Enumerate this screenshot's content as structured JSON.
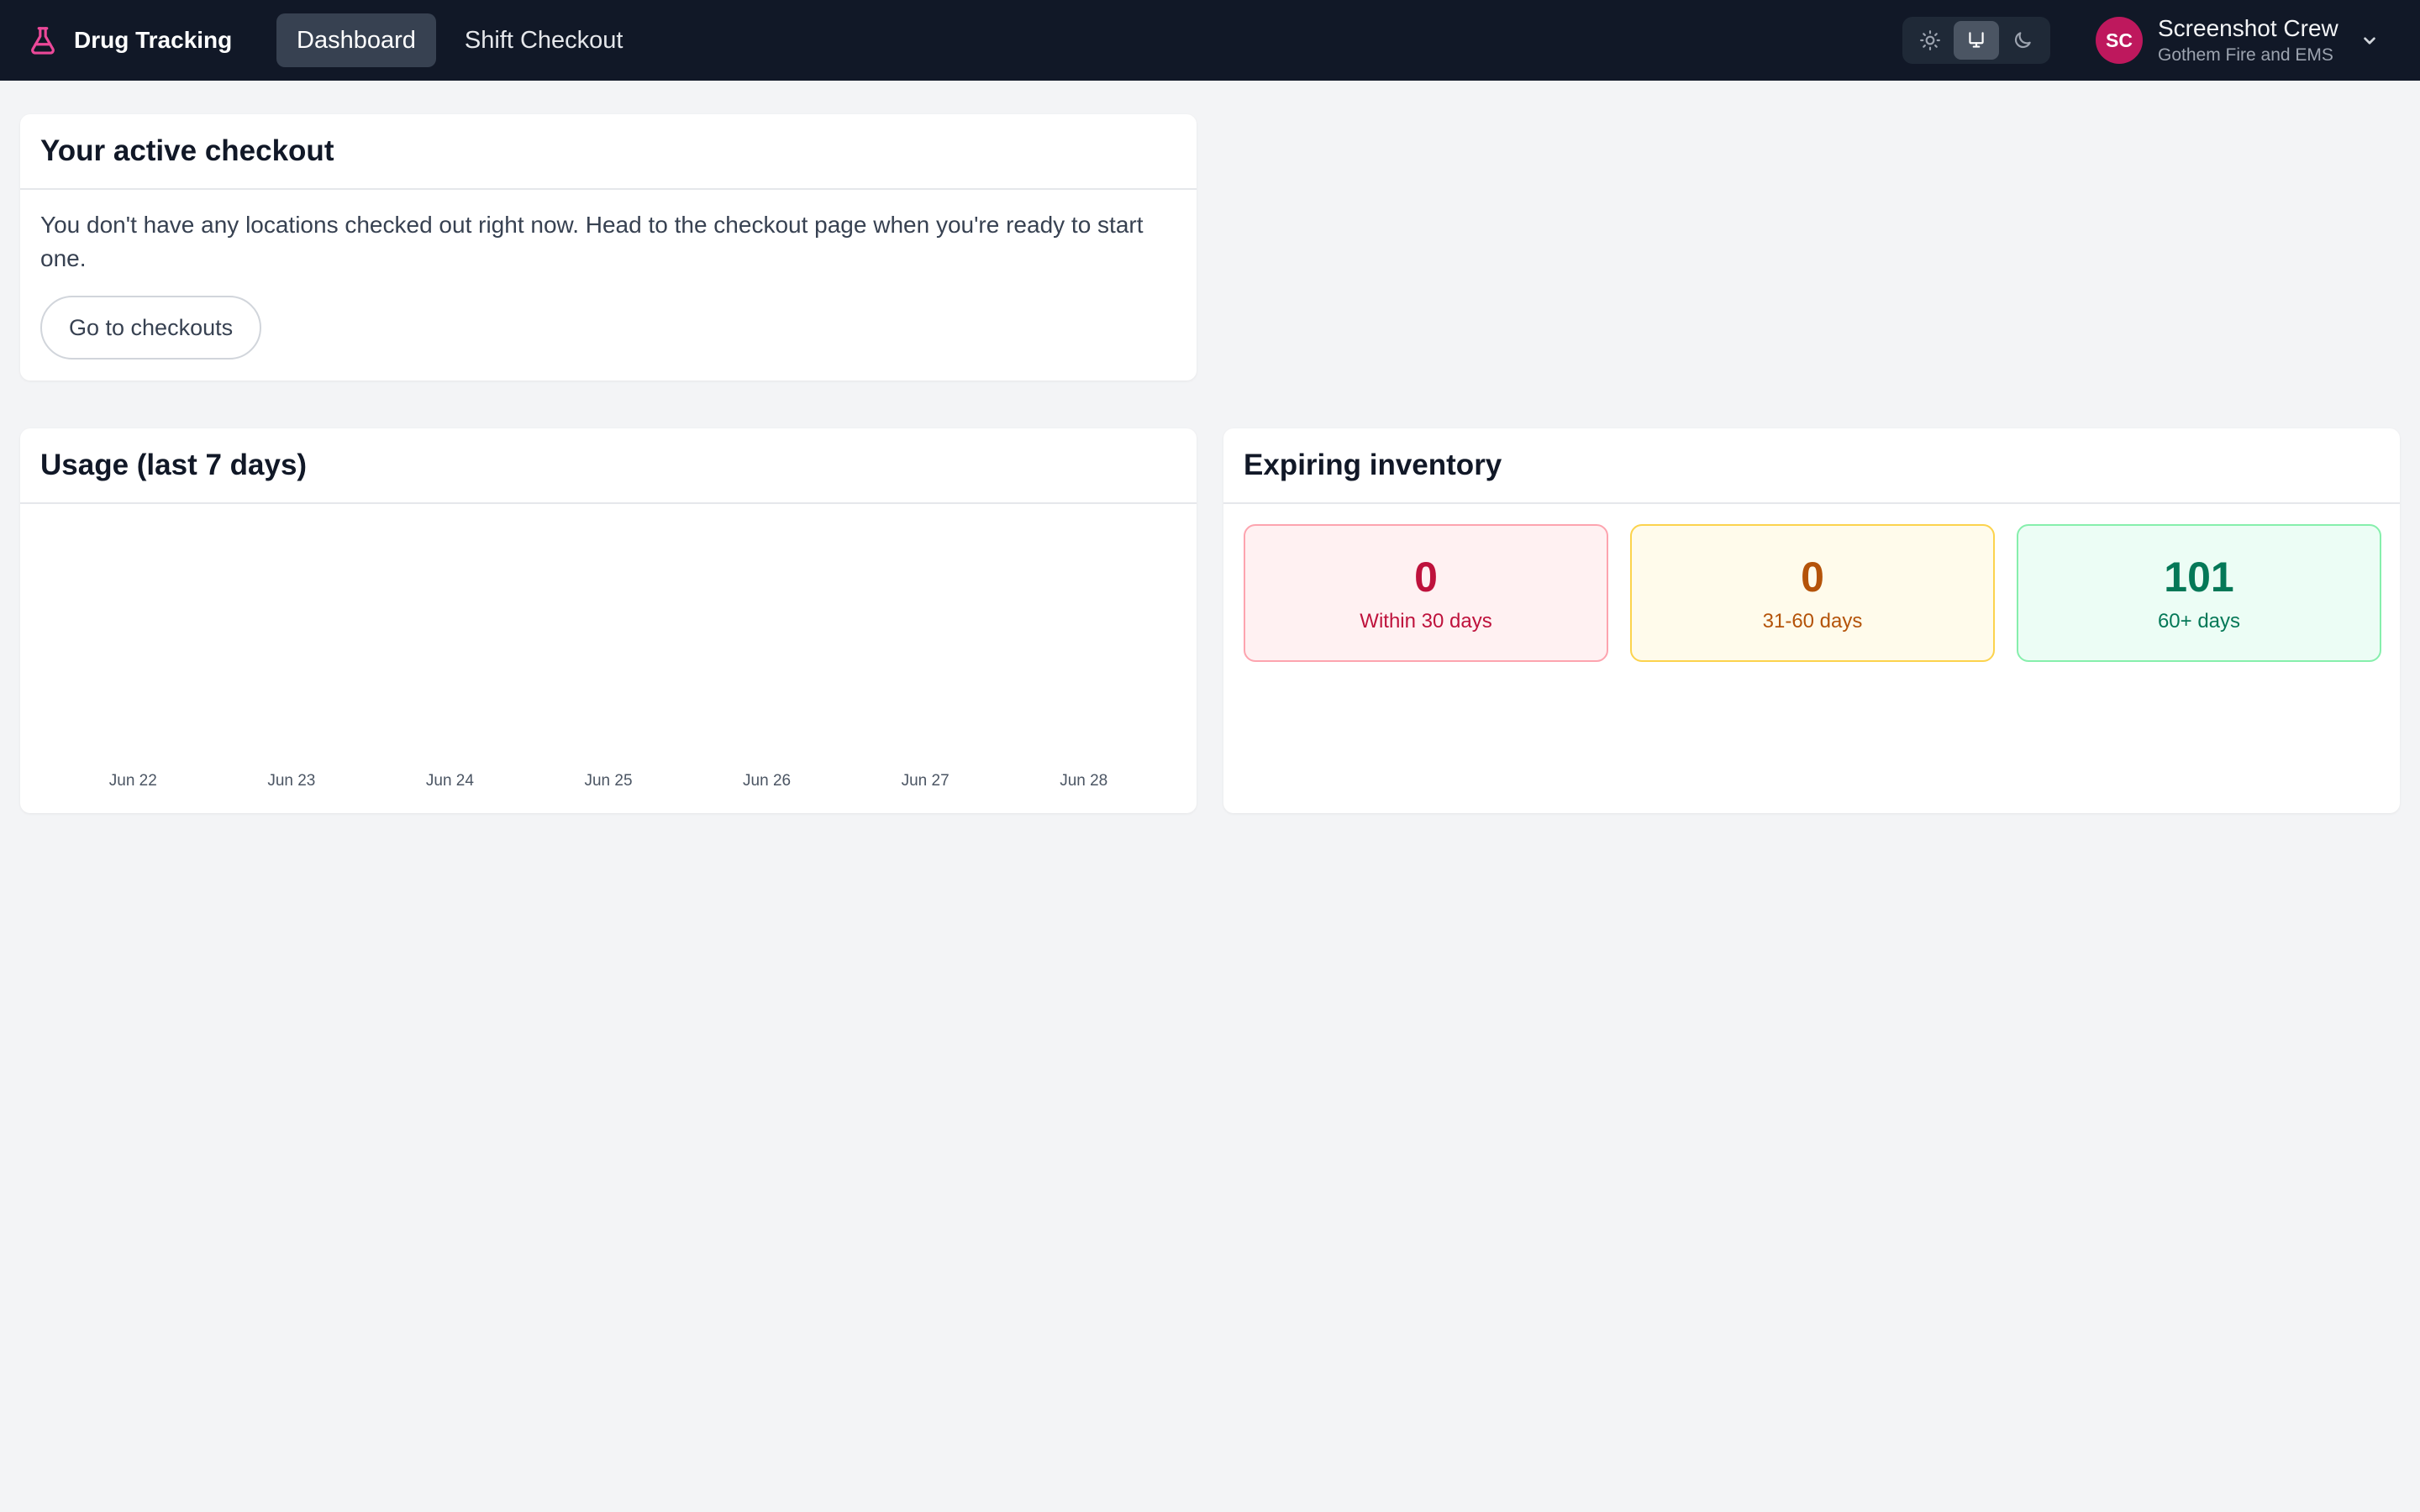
{
  "app": {
    "name": "Drug Tracking"
  },
  "nav": {
    "items": [
      {
        "label": "Dashboard",
        "active": true
      },
      {
        "label": "Shift Checkout",
        "active": false
      }
    ]
  },
  "theme": {
    "options": [
      "light",
      "system",
      "dark"
    ],
    "selected": "system"
  },
  "user": {
    "initials": "SC",
    "name": "Screenshot Crew",
    "org": "Gothem Fire and EMS"
  },
  "checkout": {
    "title": "Your active checkout",
    "message": "You don't have any locations checked out right now. Head to the checkout page when you're ready to start one.",
    "button_label": "Go to checkouts"
  },
  "usage": {
    "title": "Usage (last 7 days)"
  },
  "expiring": {
    "title": "Expiring inventory",
    "tiles": [
      {
        "count": "0",
        "label": "Within 30 days"
      },
      {
        "count": "0",
        "label": "31-60 days"
      },
      {
        "count": "101",
        "label": "60+ days"
      }
    ]
  },
  "colors": {
    "topbar": "#111827",
    "brand_icon": "#ec4899",
    "avatar": "#be185d"
  },
  "chart_data": {
    "type": "bar",
    "categories": [
      "Jun 22",
      "Jun 23",
      "Jun 24",
      "Jun 25",
      "Jun 26",
      "Jun 27",
      "Jun 28"
    ],
    "values": [
      0,
      0,
      0,
      0,
      0,
      0,
      0
    ],
    "title": "Usage (last 7 days)",
    "xlabel": "",
    "ylabel": ""
  }
}
